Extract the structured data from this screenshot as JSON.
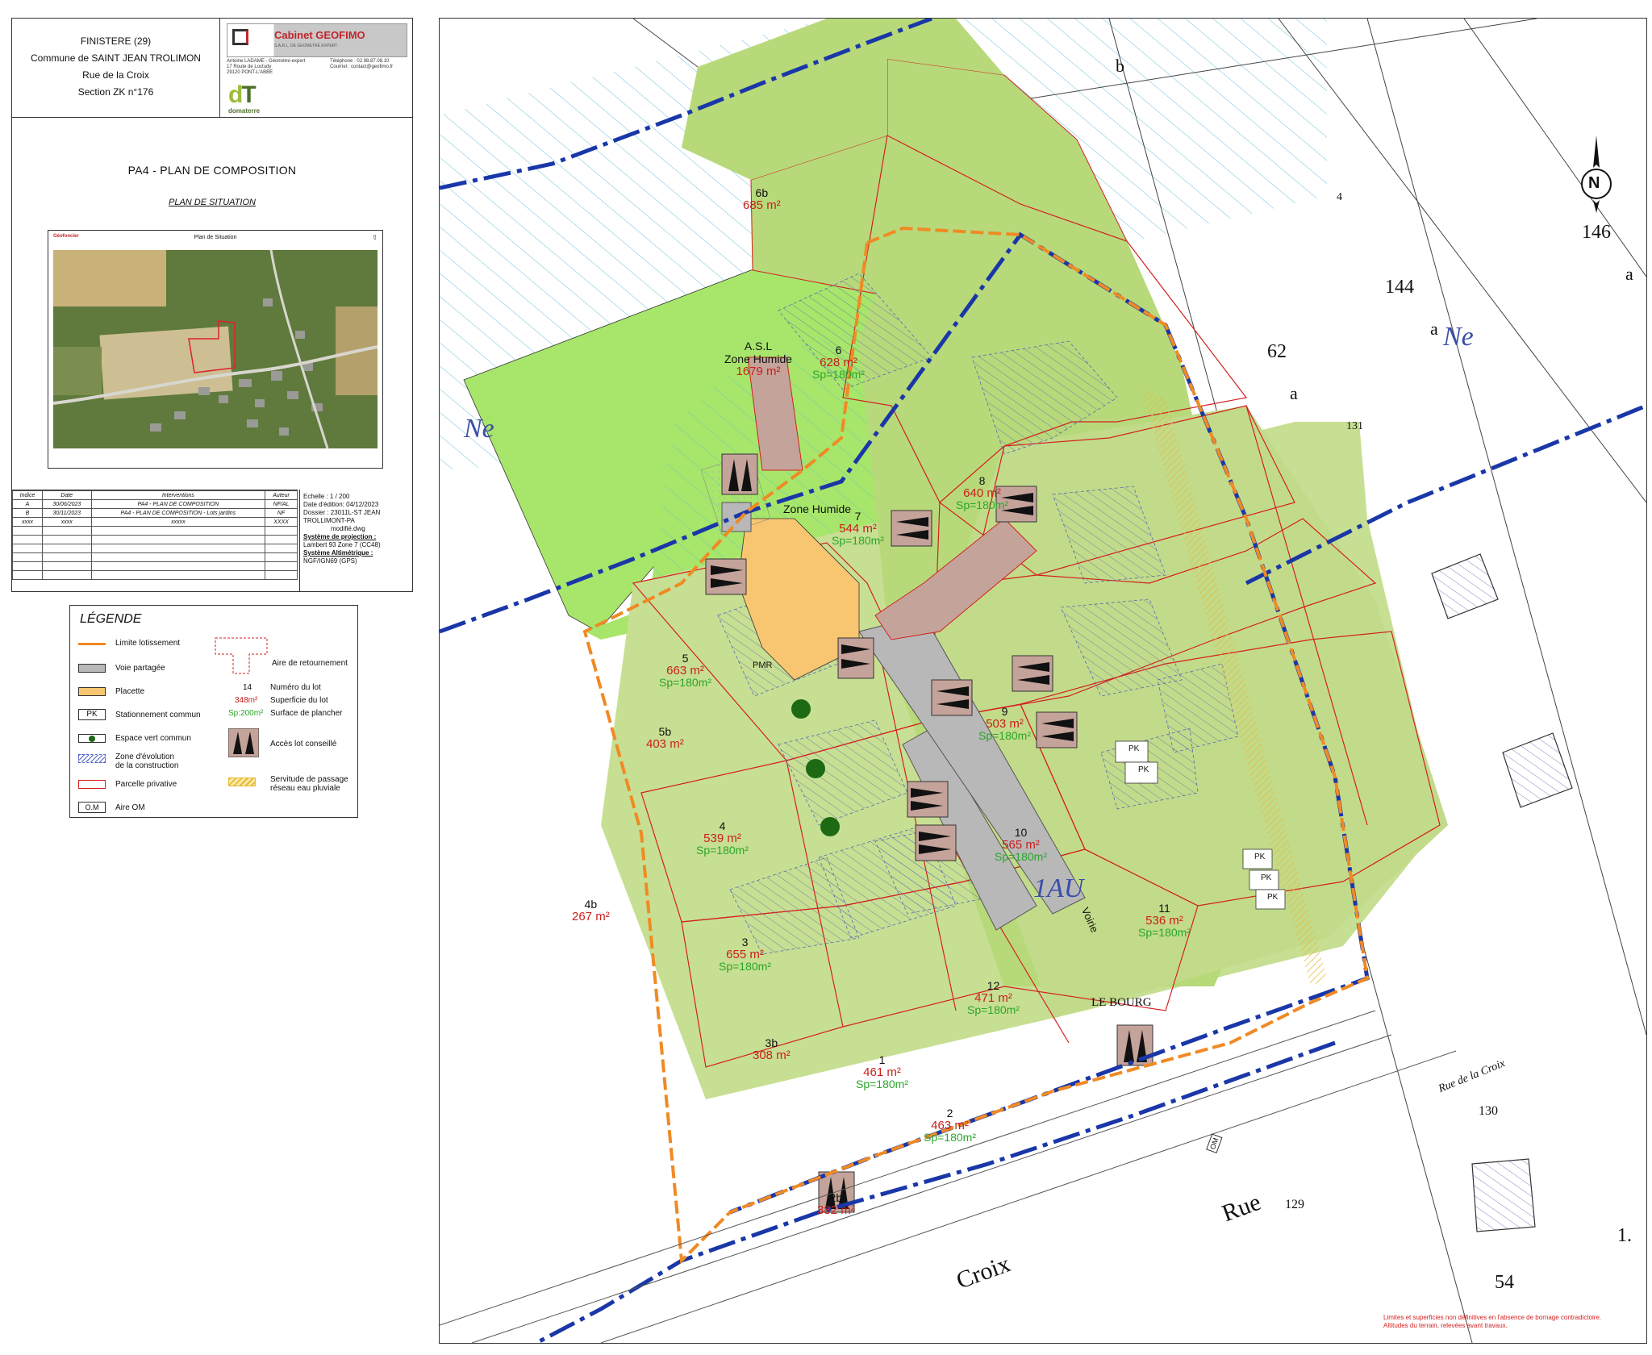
{
  "title_block": {
    "department": "FINISTERE (29)",
    "commune": "Commune de SAINT JEAN TROLIMON",
    "street": "Rue de la Croix",
    "section": "Section ZK n°176",
    "cabinet_name": "Cabinet GEOFIMO",
    "cabinet_sub": "S.A.R.L. DE GEOMETRE EXPERT",
    "contact_left": [
      "Antoine LADAME - Géomètre-expert",
      "17 Route de Loctudy",
      "29120 PONT-L'ABBE"
    ],
    "contact_right": [
      "Téléphone : 02.98.87.08.10",
      "Courriel : contact@geofimo.fr"
    ],
    "logo2": "domaterre",
    "plan_title": "PA4 - PLAN DE COMPOSITION",
    "plan_subtitle": "PLAN DE SITUATION",
    "situation_title": "Plan de Situation",
    "situation_logo": "Géofoncier",
    "table_headers": [
      "Indice",
      "Date",
      "Interventions",
      "Auteur"
    ],
    "table_rows": [
      [
        "A",
        "30/06/2023",
        "PA4 - PLAN DE COMPOSITION",
        "NF/AL"
      ],
      [
        "B",
        "30/11/2023",
        "PA4 - PLAN DE COMPOSITION - Lots jardins",
        "NF"
      ],
      [
        "xxxx",
        "xxxx",
        "xxxxx",
        "XXXX"
      ]
    ],
    "echelle": "Echelle :   1 / 200",
    "date_edition": "Date d'édition: 04/12/2023",
    "dossier": "Dossier : 23011L-ST JEAN TROLLIMONT-PA",
    "dossier_file": "modifié.dwg",
    "projection_label": "Système de projection :",
    "projection_value": "Lambert 93 Zone 7 (CC48)",
    "altimetric_label": "Système Altimétrique :",
    "altimetric_value": "NGF/IGN69 (GPS)"
  },
  "legend": {
    "title": "LÉGENDE",
    "items": {
      "limite": "Limite lotissement",
      "voie": "Voie partagée",
      "placette": "Placette",
      "stationnement": "Stationnement commun",
      "espace_vert": "Espace vert commun",
      "zone_evolution_1": "Zone d'évolution",
      "zone_evolution_2": "de la construction",
      "parcelle": "Parcelle privative",
      "aire_om": "Aire OM",
      "aire_retournement": "Aire de retournement",
      "numero_sample": "14",
      "numero": "Numéro du lot",
      "superficie_sample": "348m²",
      "superficie": "Superficie du lot",
      "surface_sample": "Sp:200m²",
      "surface": "Surface de plancher",
      "acces": "Accès lot conseillé",
      "servitude_1": "Servitude de passage",
      "servitude_2": "réseau eau pluviale",
      "pk": "PK",
      "om": "O.M"
    }
  },
  "map": {
    "zone_ne_left": "Ne",
    "zone_ne_right": "Ne",
    "zone_1au": "1AU",
    "asl_label": "A.S.L",
    "asl_zone": "Zone Humide",
    "asl_area": "1679 m²",
    "zone_humide": "Zone Humide",
    "voie": "Voirie",
    "pmr": "PMR",
    "le_bourg": "LE BOURG",
    "rue_label_1": "Rue",
    "rue_label_2": "Croix",
    "rue_label_3": "Rue de la Croix",
    "om": "OM",
    "pk": "PK",
    "parcels": [
      "b",
      "4",
      "146",
      "144",
      "a",
      "a",
      "62",
      "a",
      "131",
      "130",
      "129",
      "54",
      "1."
    ],
    "disclaimer_1": "Limites et superficies non définitives en l'absence de bornage contradictoire.",
    "disclaimer_2": "Altitudes du terrain, relevées avant travaux.",
    "lots": [
      {
        "num": "6b",
        "area": "685 m²",
        "sp": ""
      },
      {
        "num": "6",
        "area": "628 m²",
        "sp": "Sp=180m²"
      },
      {
        "num": "7",
        "area": "544 m²",
        "sp": "Sp=180m²"
      },
      {
        "num": "8",
        "area": "640 m²",
        "sp": "Sp=180m²"
      },
      {
        "num": "5",
        "area": "663 m²",
        "sp": "Sp=180m²"
      },
      {
        "num": "5b",
        "area": "403 m²",
        "sp": ""
      },
      {
        "num": "9",
        "area": "503 m²",
        "sp": "Sp=180m²"
      },
      {
        "num": "4",
        "area": "539 m²",
        "sp": "Sp=180m²"
      },
      {
        "num": "10",
        "area": "565 m²",
        "sp": "Sp=180m²"
      },
      {
        "num": "4b",
        "area": "267 m²",
        "sp": ""
      },
      {
        "num": "11",
        "area": "536 m²",
        "sp": "Sp=180m²"
      },
      {
        "num": "3",
        "area": "655 m²",
        "sp": "Sp=180m²"
      },
      {
        "num": "12",
        "area": "471 m²",
        "sp": "Sp=180m²"
      },
      {
        "num": "3b",
        "area": "308 m²",
        "sp": ""
      },
      {
        "num": "1",
        "area": "461 m²",
        "sp": "Sp=180m²"
      },
      {
        "num": "2",
        "area": "463 m²",
        "sp": "Sp=180m²"
      },
      {
        "num": "2b",
        "area": "382 m²",
        "sp": ""
      }
    ],
    "north": "N"
  },
  "colors": {
    "lot_green": "#c7df92",
    "lot_green_dark": "#a9cc6a",
    "asl_green": "#a7e66a",
    "parcel_red": "#d42020",
    "boundary_orange": "#f08a24",
    "zone_blue": "#1a37a8",
    "voie_gray": "#b8b8b8",
    "placette_yellow": "#f8c670",
    "acces_brown": "#c4a39a",
    "sp_green": "#2aa52a",
    "area_red": "#c8201c"
  }
}
